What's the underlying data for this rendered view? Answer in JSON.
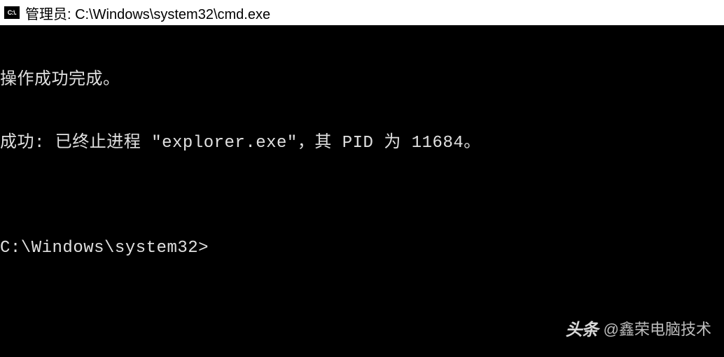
{
  "window": {
    "icon_text": "C:\\.",
    "title": "管理员: C:\\Windows\\system32\\cmd.exe"
  },
  "terminal": {
    "lines": [
      "操作成功完成。",
      "成功: 已终止进程 \"explorer.exe\"，其 PID 为 11684。",
      "",
      "C:\\Windows\\system32>"
    ]
  },
  "watermark": {
    "label": "头条",
    "handle": "@鑫荣电脑技术"
  }
}
